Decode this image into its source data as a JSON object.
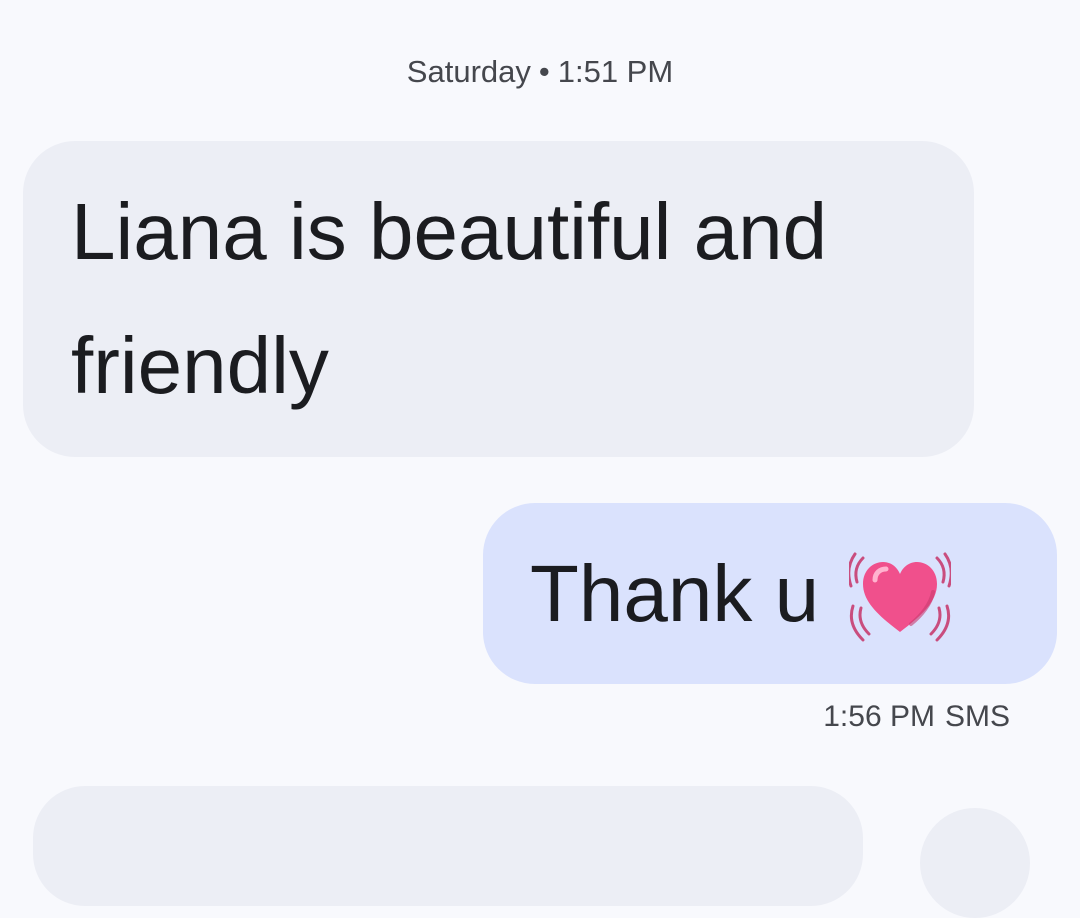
{
  "conversation": {
    "day_header": {
      "day": "Saturday",
      "separator": "•",
      "time": "1:51 PM"
    },
    "messages": [
      {
        "direction": "incoming",
        "text": "Liana is beautiful and friendly"
      },
      {
        "direction": "outgoing",
        "text": "Thank u",
        "emoji": "heart-icon",
        "time": "1:56 PM",
        "type": "SMS"
      }
    ]
  },
  "colors": {
    "background": "#f8f9fd",
    "incoming_bubble": "#eceef5",
    "outgoing_bubble": "#dae2fd",
    "text": "#1b1c20",
    "meta_text": "#45474d",
    "heart": "#f0508c"
  }
}
